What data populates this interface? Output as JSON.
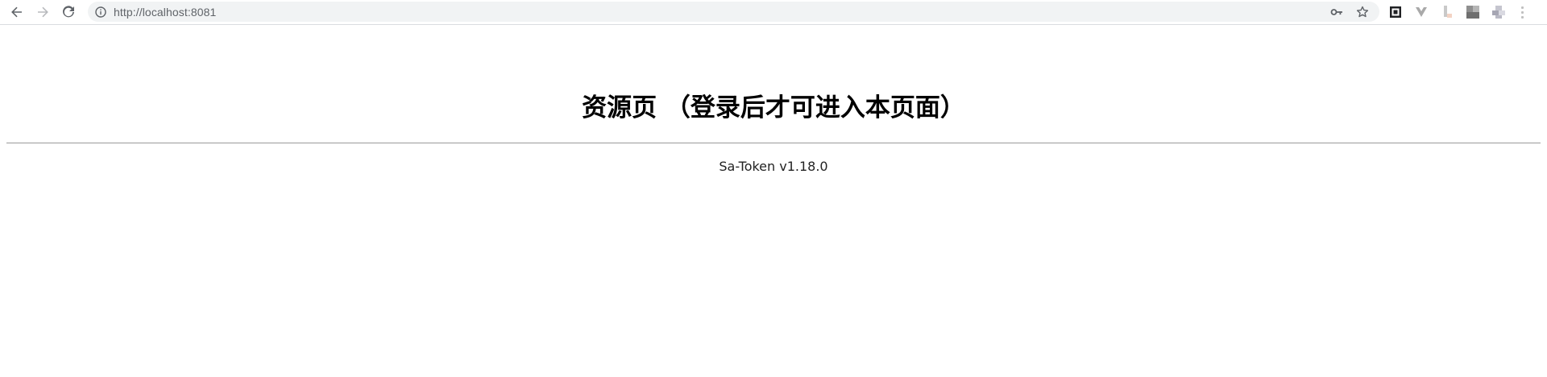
{
  "browser": {
    "url": "http://localhost:8081",
    "icons": {
      "back": "arrow-left-icon",
      "forward": "arrow-right-icon",
      "reload": "reload-icon",
      "site_info": "info-icon",
      "password_key": "key-icon",
      "bookmark": "star-icon"
    }
  },
  "page": {
    "title": "资源页 （登录后才可进入本页面）",
    "version_text": "Sa-Token v1.18.0"
  },
  "colors": {
    "toolbar_bg": "#ffffff",
    "omnibox_bg": "#f1f3f4",
    "url_text": "#5f6368",
    "title_text": "#000000",
    "divider": "#9a9a9a"
  }
}
